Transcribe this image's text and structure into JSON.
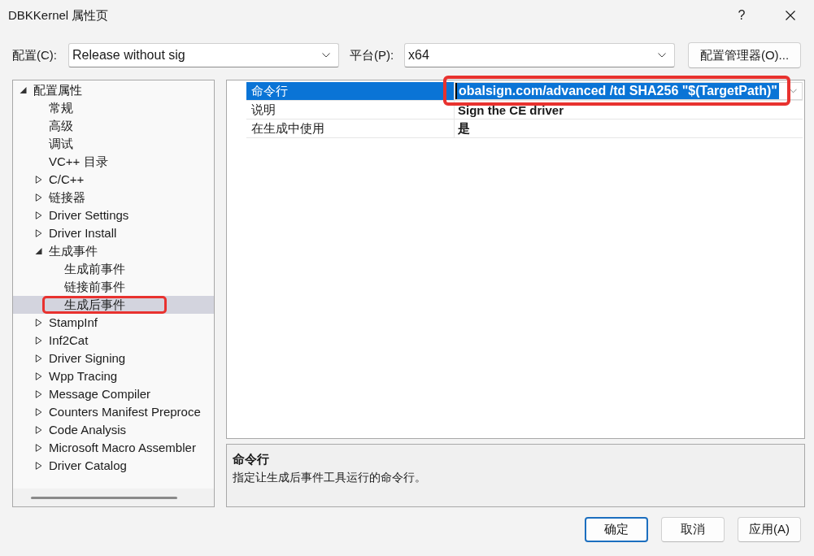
{
  "window": {
    "title": "DBKKernel 属性页",
    "help": "?"
  },
  "config_bar": {
    "configuration": {
      "label": "配置(C):",
      "value": "Release without sig"
    },
    "platform": {
      "label": "平台(P):",
      "value": "x64"
    },
    "manager_button": "配置管理器(O)..."
  },
  "tree": {
    "items": [
      {
        "label": "配置属性",
        "kind": "group",
        "expanded": true,
        "selected": false,
        "annotated": false,
        "children": [
          {
            "label": "常规",
            "kind": "leaf",
            "selected": false,
            "annotated": false
          },
          {
            "label": "高级",
            "kind": "leaf",
            "selected": false,
            "annotated": false
          },
          {
            "label": "调试",
            "kind": "leaf",
            "selected": false,
            "annotated": false
          },
          {
            "label": "VC++ 目录",
            "kind": "leaf",
            "selected": false,
            "annotated": false
          },
          {
            "label": "C/C++",
            "kind": "group",
            "expanded": false,
            "selected": false,
            "annotated": false
          },
          {
            "label": "链接器",
            "kind": "group",
            "expanded": false,
            "selected": false,
            "annotated": false
          },
          {
            "label": "Driver Settings",
            "kind": "group",
            "expanded": false,
            "selected": false,
            "annotated": false
          },
          {
            "label": "Driver Install",
            "kind": "group",
            "expanded": false,
            "selected": false,
            "annotated": false
          },
          {
            "label": "生成事件",
            "kind": "group",
            "expanded": true,
            "selected": false,
            "annotated": false,
            "children": [
              {
                "label": "生成前事件",
                "kind": "leaf",
                "selected": false,
                "annotated": false
              },
              {
                "label": "链接前事件",
                "kind": "leaf",
                "selected": false,
                "annotated": false
              },
              {
                "label": "生成后事件",
                "kind": "leaf",
                "selected": true,
                "annotated": true
              }
            ]
          },
          {
            "label": "StampInf",
            "kind": "group",
            "expanded": false,
            "selected": false,
            "annotated": false
          },
          {
            "label": "Inf2Cat",
            "kind": "group",
            "expanded": false,
            "selected": false,
            "annotated": false
          },
          {
            "label": "Driver Signing",
            "kind": "group",
            "expanded": false,
            "selected": false,
            "annotated": false
          },
          {
            "label": "Wpp Tracing",
            "kind": "group",
            "expanded": false,
            "selected": false,
            "annotated": false
          },
          {
            "label": "Message Compiler",
            "kind": "group",
            "expanded": false,
            "selected": false,
            "annotated": false
          },
          {
            "label": "Counters Manifest Preproce",
            "kind": "group",
            "expanded": false,
            "selected": false,
            "annotated": false
          },
          {
            "label": "Code Analysis",
            "kind": "group",
            "expanded": false,
            "selected": false,
            "annotated": false
          },
          {
            "label": "Microsoft Macro Assembler",
            "kind": "group",
            "expanded": false,
            "selected": false,
            "annotated": false
          },
          {
            "label": "Driver Catalog",
            "kind": "group",
            "expanded": false,
            "selected": false,
            "annotated": false
          }
        ]
      }
    ]
  },
  "property_grid": {
    "rows": [
      {
        "name": "命令行",
        "value": "obalsign.com/advanced /td SHA256 \"$(TargetPath)\"",
        "selected": true,
        "annotated": true
      },
      {
        "name": "说明",
        "value": "Sign the CE driver",
        "selected": false,
        "annotated": false
      },
      {
        "name": "在生成中使用",
        "value": "是",
        "selected": false,
        "annotated": false
      }
    ]
  },
  "description": {
    "title": "命令行",
    "text": "指定让生成后事件工具运行的命令行。"
  },
  "buttons": [
    {
      "label": "确定",
      "default": true
    },
    {
      "label": "取消",
      "default": false
    },
    {
      "label": "应用(A)",
      "default": false
    }
  ]
}
